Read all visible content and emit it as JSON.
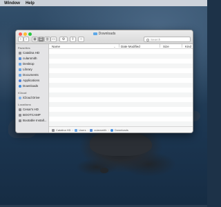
{
  "menubar": {
    "items": [
      "Window",
      "Help"
    ]
  },
  "window": {
    "title": "Downloads",
    "toolbar": {
      "back": "‹",
      "forward": "›",
      "view_icons": "▦",
      "view_list": "☰",
      "view_columns": "▥",
      "view_gallery": "▭",
      "action": "⚙",
      "share": "⇧",
      "tag": "○",
      "search_placeholder": "Search"
    },
    "sidebar": {
      "favorites_header": "Favorites",
      "favorites": [
        "Catalina HD",
        "cularsmith",
        "Desktop",
        "Library",
        "Documents",
        "Applications",
        "Downloads"
      ],
      "icloud_header": "iCloud",
      "icloud": [
        "iCloud Drive"
      ],
      "locations_header": "Locations",
      "locations": [
        "Cesar's HD",
        "BOOTCAMP",
        "Bootable Install..."
      ]
    },
    "columns": [
      "Name",
      "Date Modified",
      "Size",
      "Kind"
    ],
    "pathbar": [
      "Catalina HD",
      "Users",
      "cularsmith",
      "Downloads"
    ]
  }
}
